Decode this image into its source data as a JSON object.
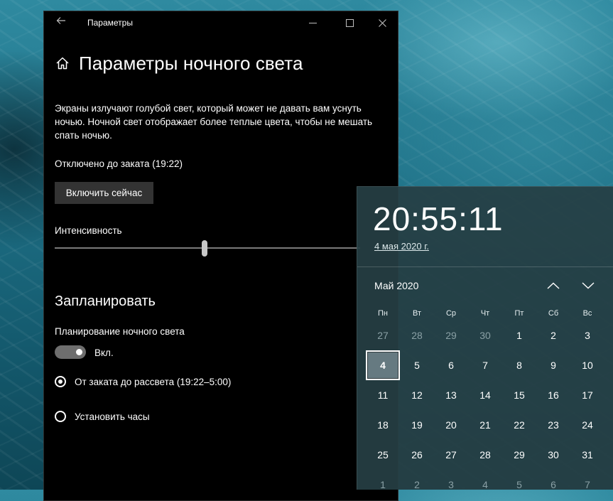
{
  "settings_window": {
    "title": "Параметры",
    "page_heading": "Параметры ночного света",
    "description": "Экраны излучают голубой свет, который может не давать вам уснуть ночью. Ночной свет отображает более теплые цвета, чтобы не мешать спать ночью.",
    "status": "Отключено до заката (19:22)",
    "turn_on_button": "Включить сейчас",
    "intensity_label": "Интенсивность",
    "intensity_value": 0.49,
    "schedule_heading": "Запланировать",
    "schedule_label": "Планирование ночного света",
    "schedule_toggle_label": "Вкл.",
    "schedule_toggle_on": true,
    "options": [
      {
        "label": "От заката до рассвета (19:22–5:00)",
        "selected": true
      },
      {
        "label": "Установить часы",
        "selected": false
      }
    ]
  },
  "clock_flyout": {
    "time": "20:55:11",
    "date": "4 мая 2020 г.",
    "month_label": "Май 2020",
    "weekdays": [
      "Пн",
      "Вт",
      "Ср",
      "Чт",
      "Пт",
      "Сб",
      "Вс"
    ],
    "weeks": [
      [
        "27",
        "28",
        "29",
        "30",
        "1",
        "2",
        "3"
      ],
      [
        "4",
        "5",
        "6",
        "7",
        "8",
        "9",
        "10"
      ],
      [
        "11",
        "12",
        "13",
        "14",
        "15",
        "16",
        "17"
      ],
      [
        "18",
        "19",
        "20",
        "21",
        "22",
        "23",
        "24"
      ],
      [
        "25",
        "26",
        "27",
        "28",
        "29",
        "30",
        "31"
      ],
      [
        "1",
        "2",
        "3",
        "4",
        "5",
        "6",
        "7"
      ]
    ],
    "today": "4"
  },
  "icons": [
    "back-arrow-icon",
    "minimize-icon",
    "maximize-icon",
    "close-icon",
    "home-icon",
    "chevron-up-icon",
    "chevron-down-icon"
  ]
}
